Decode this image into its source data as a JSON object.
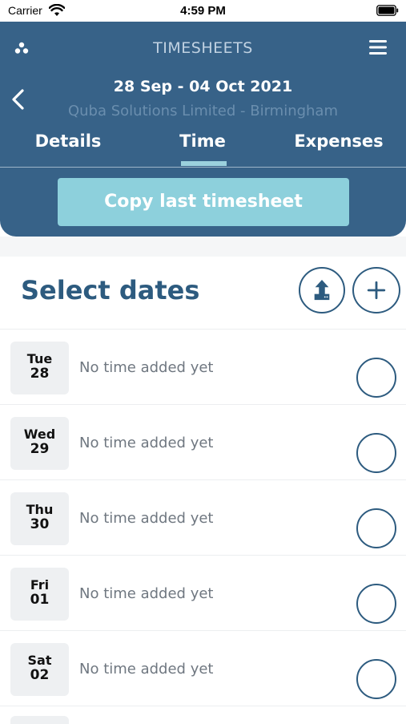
{
  "status_bar": {
    "carrier": "Carrier",
    "time": "4:59 PM"
  },
  "header": {
    "title": "TIMESHEETS",
    "date_range": "28 Sep - 04 Oct 2021",
    "company": "Quba Solutions Limited - Birmingham",
    "tabs": [
      {
        "label": "Details",
        "active": false
      },
      {
        "label": "Time",
        "active": true
      },
      {
        "label": "Expenses",
        "active": false
      }
    ],
    "copy_button_label": "Copy last timesheet"
  },
  "section": {
    "title": "Select dates"
  },
  "days": [
    {
      "day": "Tue",
      "date": "28",
      "status": "No time added yet",
      "selected": false
    },
    {
      "day": "Wed",
      "date": "29",
      "status": "No time added yet",
      "selected": false
    },
    {
      "day": "Thu",
      "date": "30",
      "status": "No time added yet",
      "selected": false
    },
    {
      "day": "Fri",
      "date": "01",
      "status": "No time added yet",
      "selected": false
    },
    {
      "day": "Sat",
      "date": "02",
      "status": "No time added yet",
      "selected": false
    }
  ],
  "icons": {
    "logo": "three-dots-logo-icon",
    "menu": "hamburger-menu-icon",
    "back": "chevron-left-icon",
    "upload": "upload-file-icon",
    "add": "plus-icon"
  },
  "colors": {
    "header_bg": "#376288",
    "accent": "#8dd0dc",
    "primary_text": "#2d5b7f"
  }
}
